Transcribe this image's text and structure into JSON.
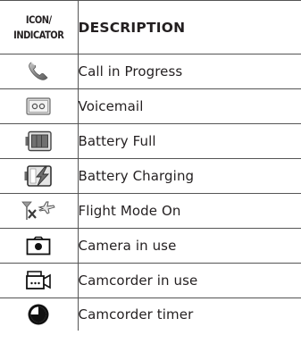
{
  "table": {
    "header": {
      "icon_col_line1": "ICON/",
      "icon_col_line2": "INDICATOR",
      "description_col": "DESCRIPTION"
    },
    "rows": [
      {
        "icon": "call-in-progress-icon",
        "description": "Call in Progress"
      },
      {
        "icon": "voicemail-icon",
        "description": "Voicemail"
      },
      {
        "icon": "battery-full-icon",
        "description": "Battery Full"
      },
      {
        "icon": "battery-charging-icon",
        "description": "Battery Charging"
      },
      {
        "icon": "flight-mode-icon",
        "description": "Flight Mode On"
      },
      {
        "icon": "camera-icon",
        "description": "Camera in use"
      },
      {
        "icon": "camcorder-icon",
        "description": "Camcorder in use"
      },
      {
        "icon": "camcorder-timer-icon",
        "description": "Camcorder timer"
      }
    ]
  }
}
